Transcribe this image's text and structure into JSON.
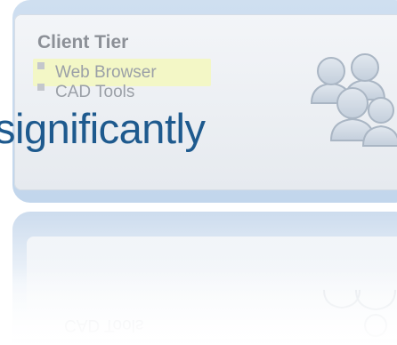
{
  "tier": {
    "title": "Client Tier",
    "items": [
      "Web Browser",
      "CAD Tools"
    ]
  },
  "overlay": {
    "word": "significantly"
  },
  "icons": {
    "users": "users-icon"
  },
  "colors": {
    "outer_band": "#c2d6ec",
    "inner_panel": "#eef1f5",
    "highlight": "#f3f7c6",
    "overlay_text": "#1e5a8e",
    "icon_fill": "#c9d3df"
  }
}
